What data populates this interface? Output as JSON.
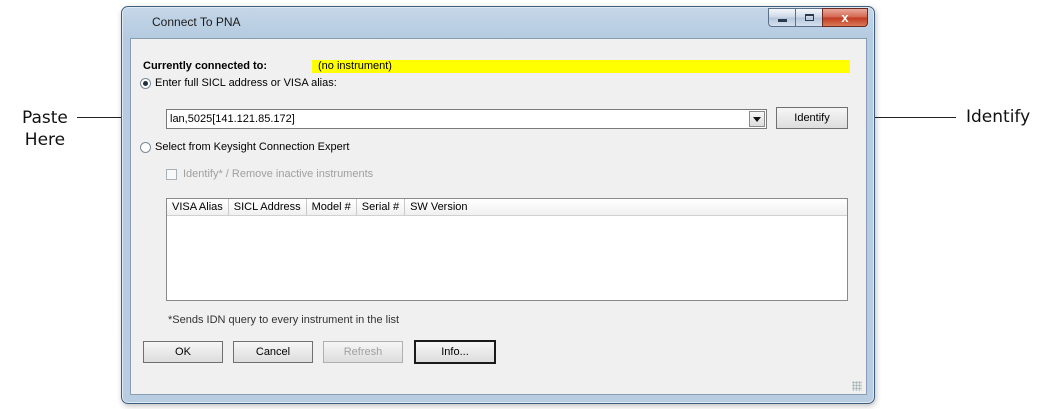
{
  "annotations": {
    "paste_line1": "Paste",
    "paste_line2": "Here",
    "identify": "Identify"
  },
  "window": {
    "title": "Connect To PNA",
    "close_glyph": "x"
  },
  "status": {
    "label": "Currently connected to:",
    "value": "(no instrument)",
    "highlight_color": "#ffff00"
  },
  "address_option": {
    "label": "Enter full SICL address or VISA alias:",
    "selected": true,
    "value": "lan,5025[141.121.85.172]",
    "identify_button": "Identify"
  },
  "expert_option": {
    "label": "Select from Keysight Connection Expert",
    "selected": false,
    "checkbox_label": "Identify* / Remove inactive instruments"
  },
  "instrument_table": {
    "columns": [
      "VISA Alias",
      "SICL Address",
      "Model #",
      "Serial #",
      "SW Version"
    ],
    "rows": []
  },
  "footnote": "*Sends IDN query to every instrument in the list",
  "buttons": {
    "ok": "OK",
    "cancel": "Cancel",
    "refresh": "Refresh",
    "info": "Info..."
  }
}
